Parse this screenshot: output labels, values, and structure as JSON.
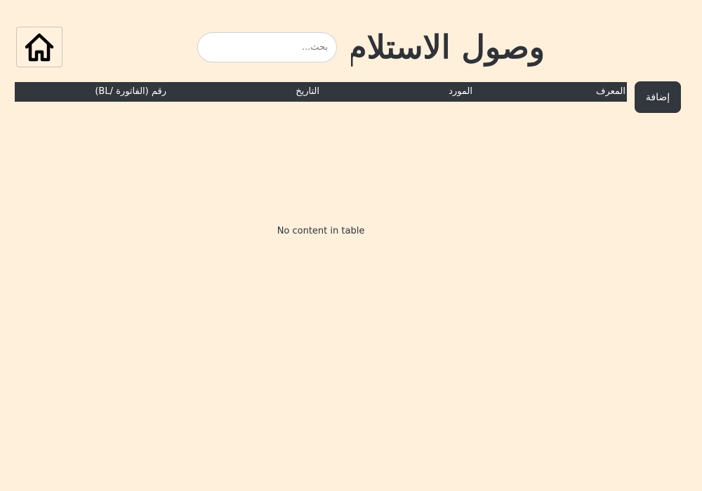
{
  "header": {
    "title": "وصول الاستلام",
    "home_icon": "home-icon"
  },
  "search": {
    "placeholder": "بحث...",
    "value": ""
  },
  "toolbar": {
    "add_label": "إضافة"
  },
  "table": {
    "columns": [
      "المعرف",
      "المورد",
      "التاريخ",
      "رقم (الفاتورة /BL)"
    ],
    "rows": [],
    "empty_message": "No content in table"
  },
  "colors": {
    "background": "#fff0dc",
    "header_bar": "#32363d",
    "button": "#32363d",
    "text": "#2f3338"
  }
}
